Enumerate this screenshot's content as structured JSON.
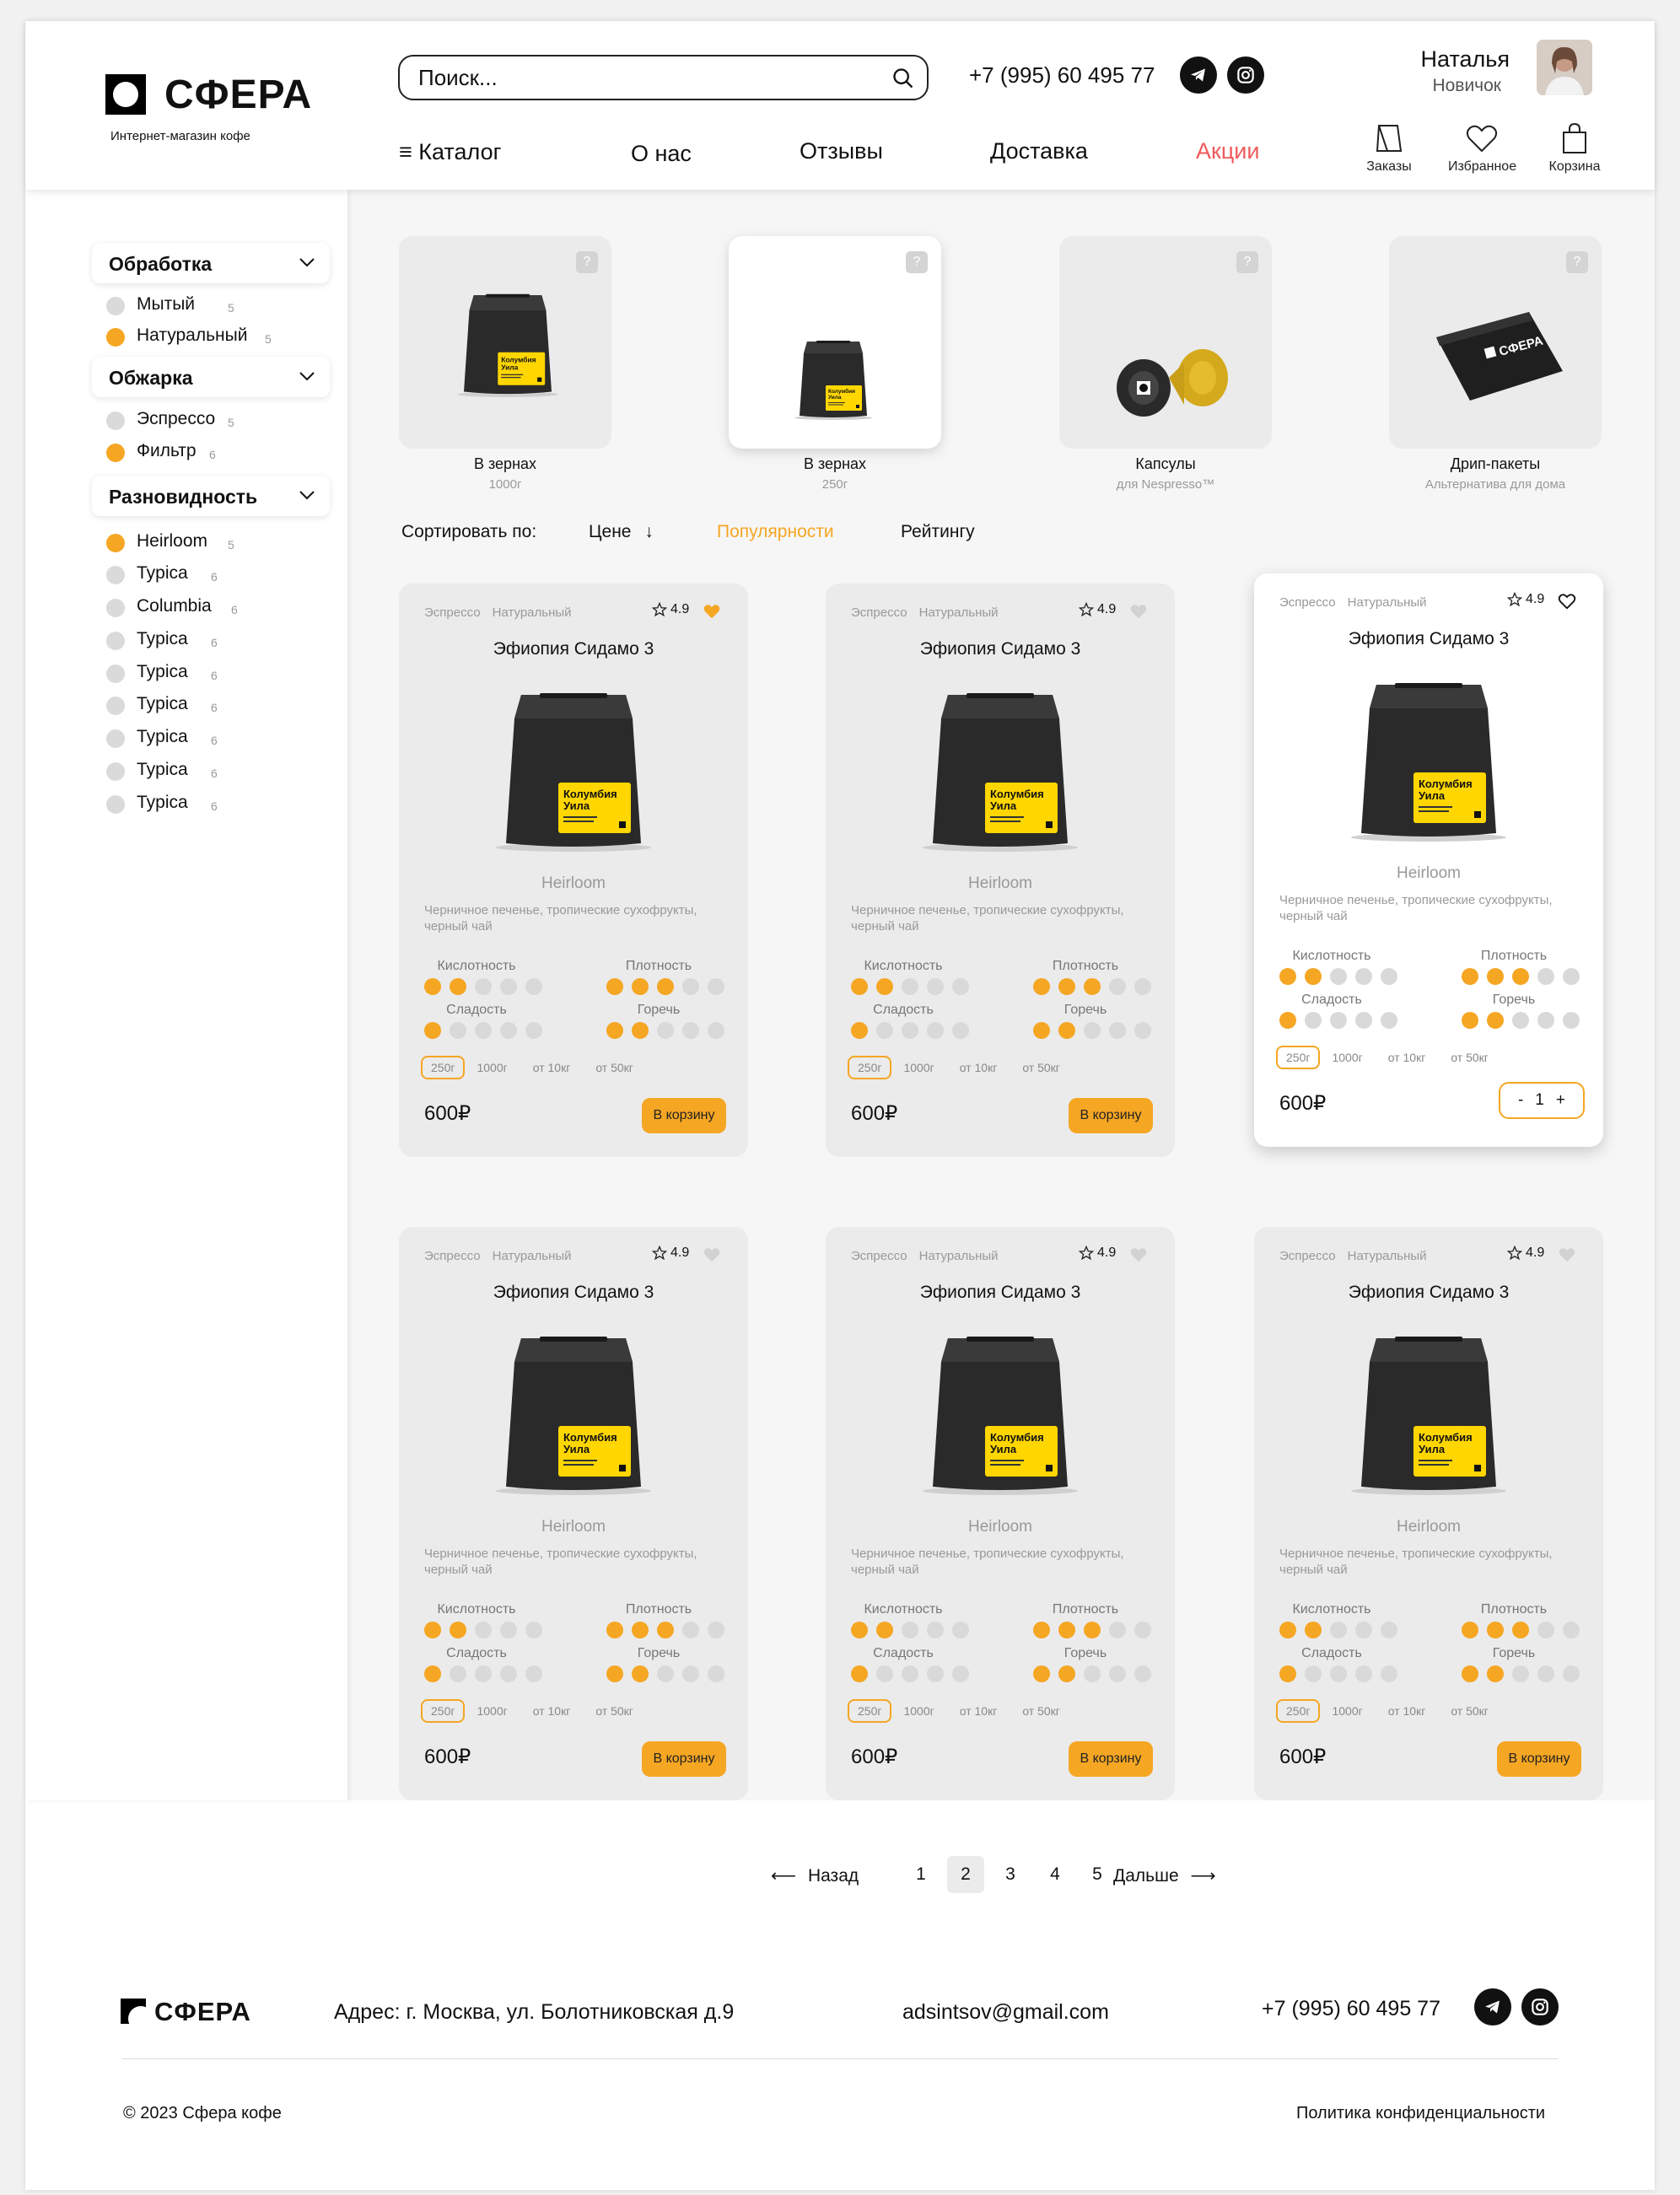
{
  "header": {
    "brand": "СФЕРА",
    "tagline": "Интернет-магазин кофе",
    "search_placeholder": "Поиск...",
    "phone": "+7 (995) 60 495 77",
    "user": {
      "name": "Наталья",
      "status": "Новичок"
    },
    "nav": [
      {
        "label": "Каталог",
        "icon": "menu-icon"
      },
      {
        "label": "О нас"
      },
      {
        "label": "Отзывы"
      },
      {
        "label": "Доставка"
      },
      {
        "label": "Акции",
        "color": "#f05a5a"
      }
    ],
    "actions": [
      {
        "label": "Заказы",
        "icon": "orders-icon"
      },
      {
        "label": "Избранное",
        "icon": "heart-icon"
      },
      {
        "label": "Корзина",
        "icon": "bag-icon"
      }
    ]
  },
  "filters": [
    {
      "title": "Обработка",
      "items": [
        {
          "label": "Мытый",
          "count": "5",
          "active": false
        },
        {
          "label": "Натуральный",
          "count": "5",
          "active": true
        }
      ]
    },
    {
      "title": "Обжарка",
      "items": [
        {
          "label": "Эспрессо",
          "count": "5",
          "active": false
        },
        {
          "label": "Фильтр",
          "count": "6",
          "active": true
        }
      ]
    },
    {
      "title": "Разновидность",
      "items": [
        {
          "label": "Heirloom",
          "count": "5",
          "active": true
        },
        {
          "label": "Typica",
          "count": "6",
          "active": false
        },
        {
          "label": "Columbia",
          "count": "6",
          "active": false
        },
        {
          "label": "Typica",
          "count": "6",
          "active": false
        },
        {
          "label": "Typica",
          "count": "6",
          "active": false
        },
        {
          "label": "Typica",
          "count": "6",
          "active": false
        },
        {
          "label": "Typica",
          "count": "6",
          "active": false
        },
        {
          "label": "Typica",
          "count": "6",
          "active": false
        },
        {
          "label": "Typica",
          "count": "6",
          "active": false
        }
      ]
    }
  ],
  "categories": [
    {
      "title": "В зернах",
      "sub": "1000г",
      "help": "?"
    },
    {
      "title": "В зернах",
      "sub": "250г",
      "help": "?",
      "selected": true
    },
    {
      "title": "Капсулы",
      "sub": "для Nespresso™",
      "help": "?"
    },
    {
      "title": "Дрип-пакеты",
      "sub": "Альтернатива для дома",
      "help": "?"
    }
  ],
  "sort": {
    "label": "Сортировать по:",
    "options": [
      "Цене",
      "Популярности",
      "Рейтингу"
    ],
    "active_color": "#f5a623"
  },
  "bag_label": "Колумбия Уила",
  "pack_brand": "СФЕРА",
  "product_template": {
    "tags": [
      "Эспрессо",
      "Натуральный"
    ],
    "rating": "4.9",
    "name": "Эфиопия Сидамо 3",
    "variety": "Heirloom",
    "description": "Черничное печенье, тропические сухофрукты, черный чай",
    "params": [
      {
        "label": "Кислотность",
        "level": 2,
        "max": 5
      },
      {
        "label": "Плотность",
        "level": 3,
        "max": 5
      },
      {
        "label": "Сладость",
        "level": 1,
        "max": 5
      },
      {
        "label": "Горечь",
        "level": 2,
        "max": 5
      }
    ],
    "weights": [
      "250г",
      "1000г",
      "от 10кг",
      "от 50кг"
    ],
    "price": "600₽",
    "cart_label": "В корзину"
  },
  "products": [
    {
      "favorite": true
    },
    {
      "favorite": false
    },
    {
      "favorite": false,
      "in_cart": true,
      "qty": "1",
      "minus": "-",
      "plus": "+"
    },
    {
      "favorite": false
    },
    {
      "favorite": false
    },
    {
      "favorite": false
    }
  ],
  "pagination": {
    "prev": "Назад",
    "next": "Дальше",
    "pages": [
      "1",
      "2",
      "3",
      "4",
      "5"
    ],
    "current": "2"
  },
  "footer": {
    "brand": "СФЕРА",
    "address": "Адрес: г. Москва, ул. Болотниковская д.9",
    "email": "adsintsov@gmail.com",
    "phone": "+7 (995) 60 495 77",
    "copyright": "© 2023 Сфера кофе",
    "policy": "Политика конфиденциальности"
  },
  "colors": {
    "accent": "#f5a623",
    "sale": "#f05a5a",
    "bag_label": "#ffd600"
  }
}
